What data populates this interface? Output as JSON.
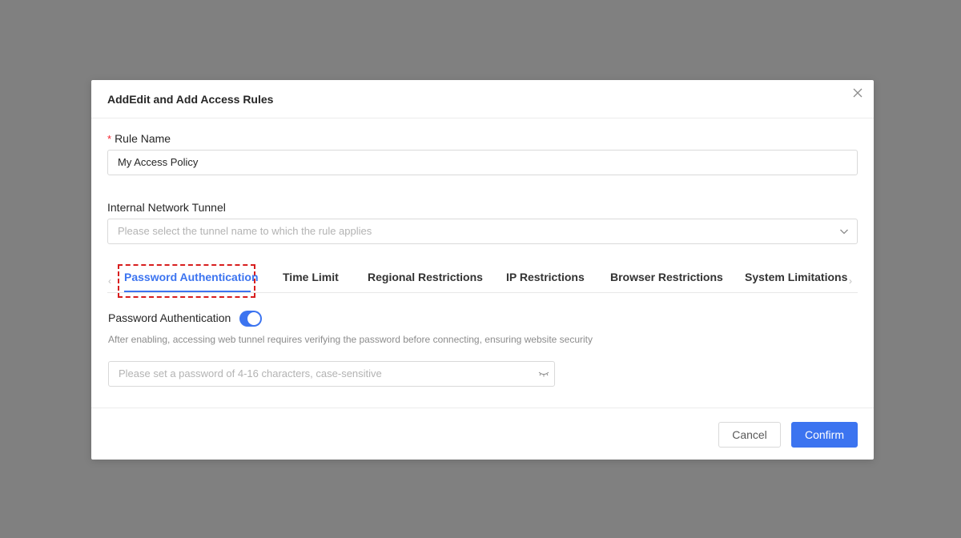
{
  "dialog": {
    "title": "AddEdit and Add Access Rules"
  },
  "rule_name": {
    "required_mark": "*",
    "label": "Rule Name",
    "value": "My Access Policy"
  },
  "tunnel": {
    "label": "Internal Network Tunnel",
    "placeholder": "Please select the tunnel name to which the rule applies"
  },
  "tabs": [
    {
      "label": "Password Authentication",
      "active": true
    },
    {
      "label": "Time Limit",
      "active": false
    },
    {
      "label": "Regional Restrictions",
      "active": false
    },
    {
      "label": "IP Restrictions",
      "active": false
    },
    {
      "label": "Browser Restrictions",
      "active": false
    },
    {
      "label": "System Limitations",
      "active": false
    }
  ],
  "password_auth": {
    "label": "Password Authentication",
    "enabled": true,
    "helper": "After enabling, accessing web tunnel requires verifying the password before connecting, ensuring website security",
    "placeholder": "Please set a password of 4-16 characters, case-sensitive"
  },
  "buttons": {
    "cancel": "Cancel",
    "confirm": "Confirm"
  },
  "colors": {
    "accent": "#3c74f0",
    "required": "#f5222d",
    "highlight": "#d81e1e",
    "overlay": "#808080"
  }
}
